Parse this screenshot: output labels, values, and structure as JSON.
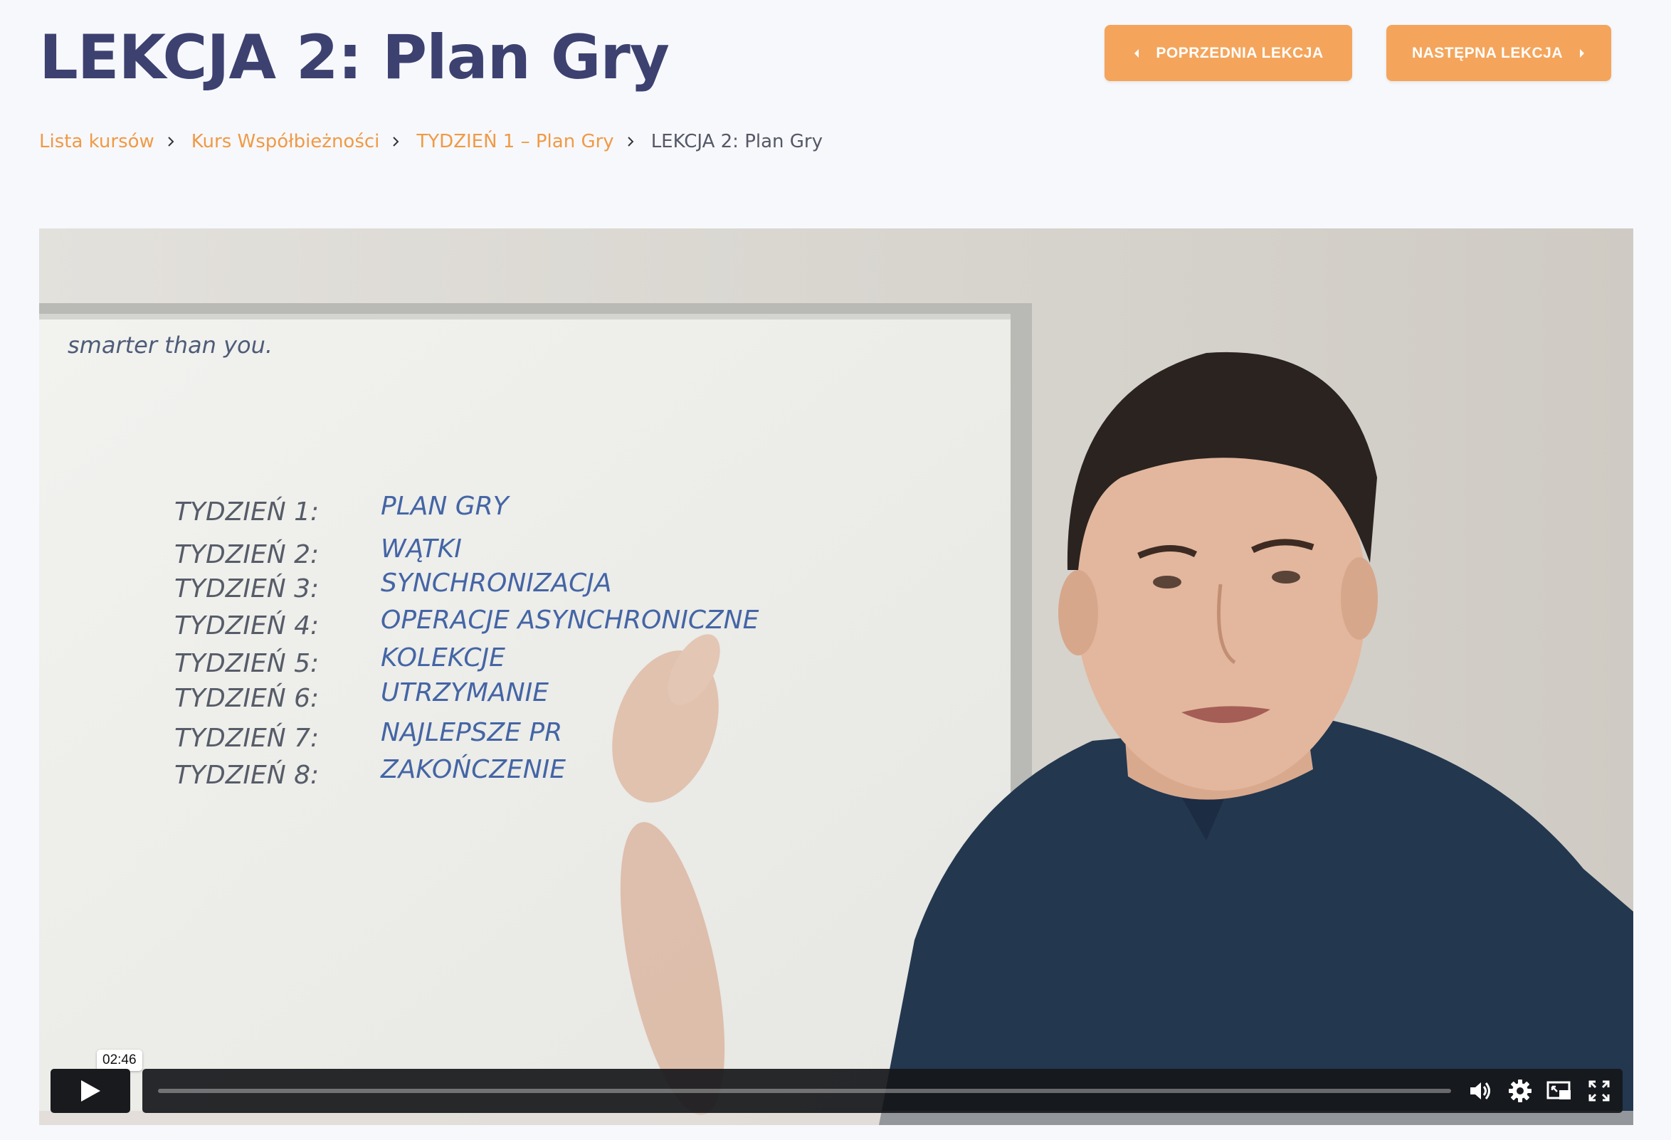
{
  "header": {
    "title": "LEKCJA 2: Plan Gry",
    "prev_button": "POPRZEDNIA LEKCJA",
    "next_button": "NASTĘPNA LEKCJA"
  },
  "breadcrumb": [
    {
      "label": "Lista kursów"
    },
    {
      "label": "Kurs Współbieżności"
    },
    {
      "label": "TYDZIEŃ 1 – Plan Gry"
    },
    {
      "label": "LEKCJA 2: Plan Gry"
    }
  ],
  "video": {
    "whiteboard_header": "smarter than you.",
    "whiteboard": [
      {
        "week": "TYDZIEŃ 1:",
        "topic": "PLAN GRY"
      },
      {
        "week": "TYDZIEŃ 2:",
        "topic": "WĄTKI"
      },
      {
        "week": "TYDZIEŃ 3:",
        "topic": "SYNCHRONIZACJA"
      },
      {
        "week": "TYDZIEŃ 4:",
        "topic": "OPERACJE ASYNCHRONICZNE"
      },
      {
        "week": "TYDZIEŃ 5:",
        "topic": "KOLEKCJE"
      },
      {
        "week": "TYDZIEŃ 6:",
        "topic": "UTRZYMANIE"
      },
      {
        "week": "TYDZIEŃ 7:",
        "topic": "NAJLEPSZE PR"
      },
      {
        "week": "TYDZIEŃ 8:",
        "topic": "ZAKOŃCZENIE"
      }
    ],
    "time_tooltip": "02:46",
    "progress": 0
  },
  "icons": [
    "chevron-left-icon",
    "chevron-right-icon",
    "play-icon",
    "volume-icon",
    "settings-icon",
    "picture-in-picture-icon",
    "fullscreen-icon"
  ],
  "colors": {
    "title": "#3c4170",
    "accent": "#f4a55b",
    "link": "#f09a45",
    "background": "#f7f8fc"
  }
}
